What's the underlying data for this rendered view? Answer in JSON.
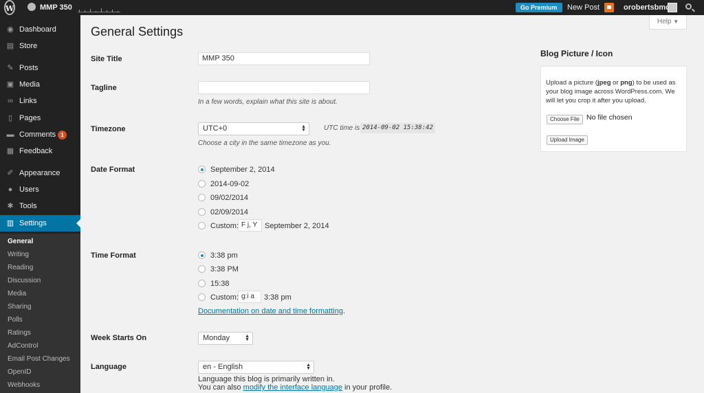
{
  "adminbar": {
    "site_name": "MMP 350",
    "go_premium": "Go Premium",
    "new_post": "New Post",
    "username": "orobertsbmcc"
  },
  "sidebar": {
    "items": [
      {
        "label": "Dashboard",
        "icon": "dashboard-icon",
        "glyph": "◉"
      },
      {
        "label": "Store",
        "icon": "cart-icon",
        "glyph": "▤"
      },
      {
        "label": "Posts",
        "icon": "pin-icon",
        "glyph": "✎"
      },
      {
        "label": "Media",
        "icon": "media-icon",
        "glyph": "▣"
      },
      {
        "label": "Links",
        "icon": "link-icon",
        "glyph": "∞"
      },
      {
        "label": "Pages",
        "icon": "pages-icon",
        "glyph": "▯"
      },
      {
        "label": "Comments",
        "icon": "comment-icon",
        "glyph": "▬",
        "badge": "1"
      },
      {
        "label": "Feedback",
        "icon": "feedback-icon",
        "glyph": "▦"
      },
      {
        "label": "Appearance",
        "icon": "brush-icon",
        "glyph": "✐"
      },
      {
        "label": "Users",
        "icon": "user-icon",
        "glyph": "●"
      },
      {
        "label": "Tools",
        "icon": "wrench-icon",
        "glyph": "✱"
      },
      {
        "label": "Settings",
        "icon": "settings-icon",
        "glyph": "▥"
      }
    ],
    "submenu": [
      "General",
      "Writing",
      "Reading",
      "Discussion",
      "Media",
      "Sharing",
      "Polls",
      "Ratings",
      "AdControl",
      "Email Post Changes",
      "OpenID",
      "Webhooks"
    ]
  },
  "help_label": "Help",
  "page_title": "General Settings",
  "form": {
    "site_title_label": "Site Title",
    "site_title_value": "MMP 350",
    "tagline_label": "Tagline",
    "tagline_value": "",
    "tagline_desc": "In a few words, explain what this site is about.",
    "timezone_label": "Timezone",
    "timezone_value": "UTC+0",
    "utc_label": "UTC time is",
    "utc_time": "2014-09-02 15:38:42",
    "timezone_desc": "Choose a city in the same timezone as you.",
    "date_format_label": "Date Format",
    "date_options": [
      "September 2, 2014",
      "2014-09-02",
      "09/02/2014",
      "02/09/2014"
    ],
    "date_custom_label": "Custom:",
    "date_custom_value": "F j, Y",
    "date_custom_sample": "September 2, 2014",
    "time_format_label": "Time Format",
    "time_options": [
      "3:38 pm",
      "3:38 PM",
      "15:38"
    ],
    "time_custom_label": "Custom:",
    "time_custom_value": "g:i a",
    "time_custom_sample": "3:38 pm",
    "doc_link": "Documentation on date and time formatting",
    "doc_link_suffix": ".",
    "week_label": "Week Starts On",
    "week_value": "Monday",
    "language_label": "Language",
    "language_value": "en - English",
    "language_desc": "Language this blog is primarily written in.",
    "language_desc2_prefix": "You can also",
    "language_desc2_link": "modify the interface language",
    "language_desc2_suffix": "in your profile."
  },
  "blog_picture": {
    "title": "Blog Picture / Icon",
    "text_1": "Upload a picture (",
    "jpeg": "jpeg",
    "text_or": " or ",
    "png": "png",
    "text_2": ") to be used as your blog image across WordPress.com. We will let you crop it after you upload.",
    "choose_file": "Choose File",
    "no_file": "No file chosen",
    "upload_button": "Upload Image"
  }
}
